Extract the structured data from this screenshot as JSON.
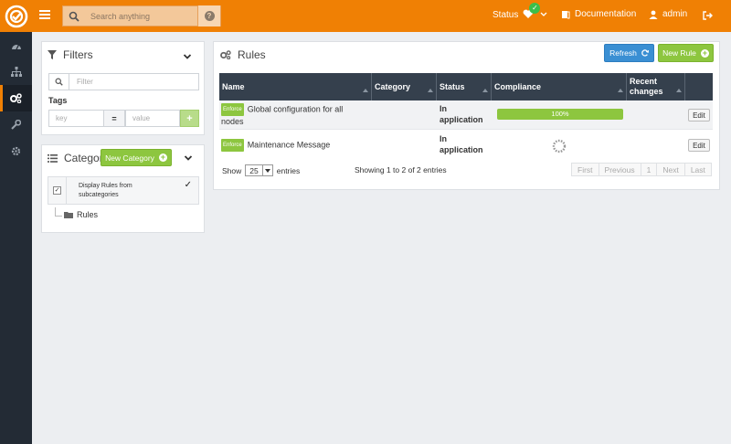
{
  "topbar": {
    "search_placeholder": "Search anything",
    "status_label": "Status",
    "documentation_label": "Documentation",
    "user_label": "admin"
  },
  "sidebar": {
    "items": [
      {
        "icon": "dashboard-icon"
      },
      {
        "icon": "nodes-icon"
      },
      {
        "icon": "rules-icon",
        "active": true
      },
      {
        "icon": "wrench-icon"
      },
      {
        "icon": "settings-icon"
      }
    ]
  },
  "filters": {
    "title": "Filters",
    "filter_placeholder": "Filter",
    "tags_label": "Tags",
    "key_placeholder": "key",
    "equals": "=",
    "value_placeholder": "value",
    "add_label": "+"
  },
  "categories": {
    "title": "Categor",
    "new_category_label": "New Category",
    "checkbox_label_line1": "Display Rules from",
    "checkbox_label_line2": "subcategories",
    "tree_root": "Rules"
  },
  "rules": {
    "title": "Rules",
    "refresh_label": "Refresh",
    "new_rule_label": "New Rule",
    "columns": [
      "Name",
      "Category",
      "Status",
      "Compliance",
      "Recent changes"
    ],
    "rows": [
      {
        "badge": "Enforce",
        "name_line1": "Global configuration for all",
        "name_line2": "nodes",
        "status_line1": "In",
        "status_line2": "application",
        "compliance": "100%",
        "compliance_value": 100,
        "edit": "Edit"
      },
      {
        "badge": "Enforce",
        "name_line1": "Maintenance Message",
        "name_line2": "",
        "status_line1": "In",
        "status_line2": "application",
        "compliance": "",
        "compliance_value": null,
        "edit": "Edit"
      }
    ],
    "show_label": "Show",
    "page_size": "25",
    "entries_label": "entries",
    "info": "Showing 1 to 2 of 2 entries",
    "pager": [
      "First",
      "Previous",
      "1",
      "Next",
      "Last"
    ]
  },
  "colors": {
    "accent": "#f08004",
    "sidebar_bg": "#232b35",
    "table_header": "#35404d",
    "success": "#8dc63f",
    "primary": "#3a8fd3"
  }
}
